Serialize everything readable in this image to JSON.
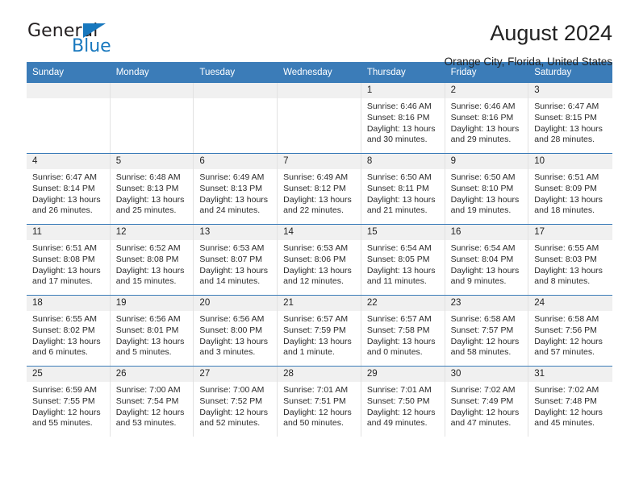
{
  "brand": {
    "name_dark": "General",
    "name_blue": "Blue",
    "accent_color": "#1878be"
  },
  "header": {
    "title": "August 2024",
    "subtitle": "Orange City, Florida, United States",
    "header_bg_color": "#3b7cb8",
    "day_band_color": "#f0f0f0"
  },
  "weekdays": [
    "Sunday",
    "Monday",
    "Tuesday",
    "Wednesday",
    "Thursday",
    "Friday",
    "Saturday"
  ],
  "weeks": [
    [
      {
        "day": "",
        "sunrise": "",
        "sunset": "",
        "daylight": "",
        "empty": true
      },
      {
        "day": "",
        "sunrise": "",
        "sunset": "",
        "daylight": "",
        "empty": true
      },
      {
        "day": "",
        "sunrise": "",
        "sunset": "",
        "daylight": "",
        "empty": true
      },
      {
        "day": "",
        "sunrise": "",
        "sunset": "",
        "daylight": "",
        "empty": true
      },
      {
        "day": "1",
        "sunrise": "Sunrise: 6:46 AM",
        "sunset": "Sunset: 8:16 PM",
        "daylight": "Daylight: 13 hours and 30 minutes."
      },
      {
        "day": "2",
        "sunrise": "Sunrise: 6:46 AM",
        "sunset": "Sunset: 8:16 PM",
        "daylight": "Daylight: 13 hours and 29 minutes."
      },
      {
        "day": "3",
        "sunrise": "Sunrise: 6:47 AM",
        "sunset": "Sunset: 8:15 PM",
        "daylight": "Daylight: 13 hours and 28 minutes."
      }
    ],
    [
      {
        "day": "4",
        "sunrise": "Sunrise: 6:47 AM",
        "sunset": "Sunset: 8:14 PM",
        "daylight": "Daylight: 13 hours and 26 minutes."
      },
      {
        "day": "5",
        "sunrise": "Sunrise: 6:48 AM",
        "sunset": "Sunset: 8:13 PM",
        "daylight": "Daylight: 13 hours and 25 minutes."
      },
      {
        "day": "6",
        "sunrise": "Sunrise: 6:49 AM",
        "sunset": "Sunset: 8:13 PM",
        "daylight": "Daylight: 13 hours and 24 minutes."
      },
      {
        "day": "7",
        "sunrise": "Sunrise: 6:49 AM",
        "sunset": "Sunset: 8:12 PM",
        "daylight": "Daylight: 13 hours and 22 minutes."
      },
      {
        "day": "8",
        "sunrise": "Sunrise: 6:50 AM",
        "sunset": "Sunset: 8:11 PM",
        "daylight": "Daylight: 13 hours and 21 minutes."
      },
      {
        "day": "9",
        "sunrise": "Sunrise: 6:50 AM",
        "sunset": "Sunset: 8:10 PM",
        "daylight": "Daylight: 13 hours and 19 minutes."
      },
      {
        "day": "10",
        "sunrise": "Sunrise: 6:51 AM",
        "sunset": "Sunset: 8:09 PM",
        "daylight": "Daylight: 13 hours and 18 minutes."
      }
    ],
    [
      {
        "day": "11",
        "sunrise": "Sunrise: 6:51 AM",
        "sunset": "Sunset: 8:08 PM",
        "daylight": "Daylight: 13 hours and 17 minutes."
      },
      {
        "day": "12",
        "sunrise": "Sunrise: 6:52 AM",
        "sunset": "Sunset: 8:08 PM",
        "daylight": "Daylight: 13 hours and 15 minutes."
      },
      {
        "day": "13",
        "sunrise": "Sunrise: 6:53 AM",
        "sunset": "Sunset: 8:07 PM",
        "daylight": "Daylight: 13 hours and 14 minutes."
      },
      {
        "day": "14",
        "sunrise": "Sunrise: 6:53 AM",
        "sunset": "Sunset: 8:06 PM",
        "daylight": "Daylight: 13 hours and 12 minutes."
      },
      {
        "day": "15",
        "sunrise": "Sunrise: 6:54 AM",
        "sunset": "Sunset: 8:05 PM",
        "daylight": "Daylight: 13 hours and 11 minutes."
      },
      {
        "day": "16",
        "sunrise": "Sunrise: 6:54 AM",
        "sunset": "Sunset: 8:04 PM",
        "daylight": "Daylight: 13 hours and 9 minutes."
      },
      {
        "day": "17",
        "sunrise": "Sunrise: 6:55 AM",
        "sunset": "Sunset: 8:03 PM",
        "daylight": "Daylight: 13 hours and 8 minutes."
      }
    ],
    [
      {
        "day": "18",
        "sunrise": "Sunrise: 6:55 AM",
        "sunset": "Sunset: 8:02 PM",
        "daylight": "Daylight: 13 hours and 6 minutes."
      },
      {
        "day": "19",
        "sunrise": "Sunrise: 6:56 AM",
        "sunset": "Sunset: 8:01 PM",
        "daylight": "Daylight: 13 hours and 5 minutes."
      },
      {
        "day": "20",
        "sunrise": "Sunrise: 6:56 AM",
        "sunset": "Sunset: 8:00 PM",
        "daylight": "Daylight: 13 hours and 3 minutes."
      },
      {
        "day": "21",
        "sunrise": "Sunrise: 6:57 AM",
        "sunset": "Sunset: 7:59 PM",
        "daylight": "Daylight: 13 hours and 1 minute."
      },
      {
        "day": "22",
        "sunrise": "Sunrise: 6:57 AM",
        "sunset": "Sunset: 7:58 PM",
        "daylight": "Daylight: 13 hours and 0 minutes."
      },
      {
        "day": "23",
        "sunrise": "Sunrise: 6:58 AM",
        "sunset": "Sunset: 7:57 PM",
        "daylight": "Daylight: 12 hours and 58 minutes."
      },
      {
        "day": "24",
        "sunrise": "Sunrise: 6:58 AM",
        "sunset": "Sunset: 7:56 PM",
        "daylight": "Daylight: 12 hours and 57 minutes."
      }
    ],
    [
      {
        "day": "25",
        "sunrise": "Sunrise: 6:59 AM",
        "sunset": "Sunset: 7:55 PM",
        "daylight": "Daylight: 12 hours and 55 minutes."
      },
      {
        "day": "26",
        "sunrise": "Sunrise: 7:00 AM",
        "sunset": "Sunset: 7:54 PM",
        "daylight": "Daylight: 12 hours and 53 minutes."
      },
      {
        "day": "27",
        "sunrise": "Sunrise: 7:00 AM",
        "sunset": "Sunset: 7:52 PM",
        "daylight": "Daylight: 12 hours and 52 minutes."
      },
      {
        "day": "28",
        "sunrise": "Sunrise: 7:01 AM",
        "sunset": "Sunset: 7:51 PM",
        "daylight": "Daylight: 12 hours and 50 minutes."
      },
      {
        "day": "29",
        "sunrise": "Sunrise: 7:01 AM",
        "sunset": "Sunset: 7:50 PM",
        "daylight": "Daylight: 12 hours and 49 minutes."
      },
      {
        "day": "30",
        "sunrise": "Sunrise: 7:02 AM",
        "sunset": "Sunset: 7:49 PM",
        "daylight": "Daylight: 12 hours and 47 minutes."
      },
      {
        "day": "31",
        "sunrise": "Sunrise: 7:02 AM",
        "sunset": "Sunset: 7:48 PM",
        "daylight": "Daylight: 12 hours and 45 minutes."
      }
    ]
  ]
}
